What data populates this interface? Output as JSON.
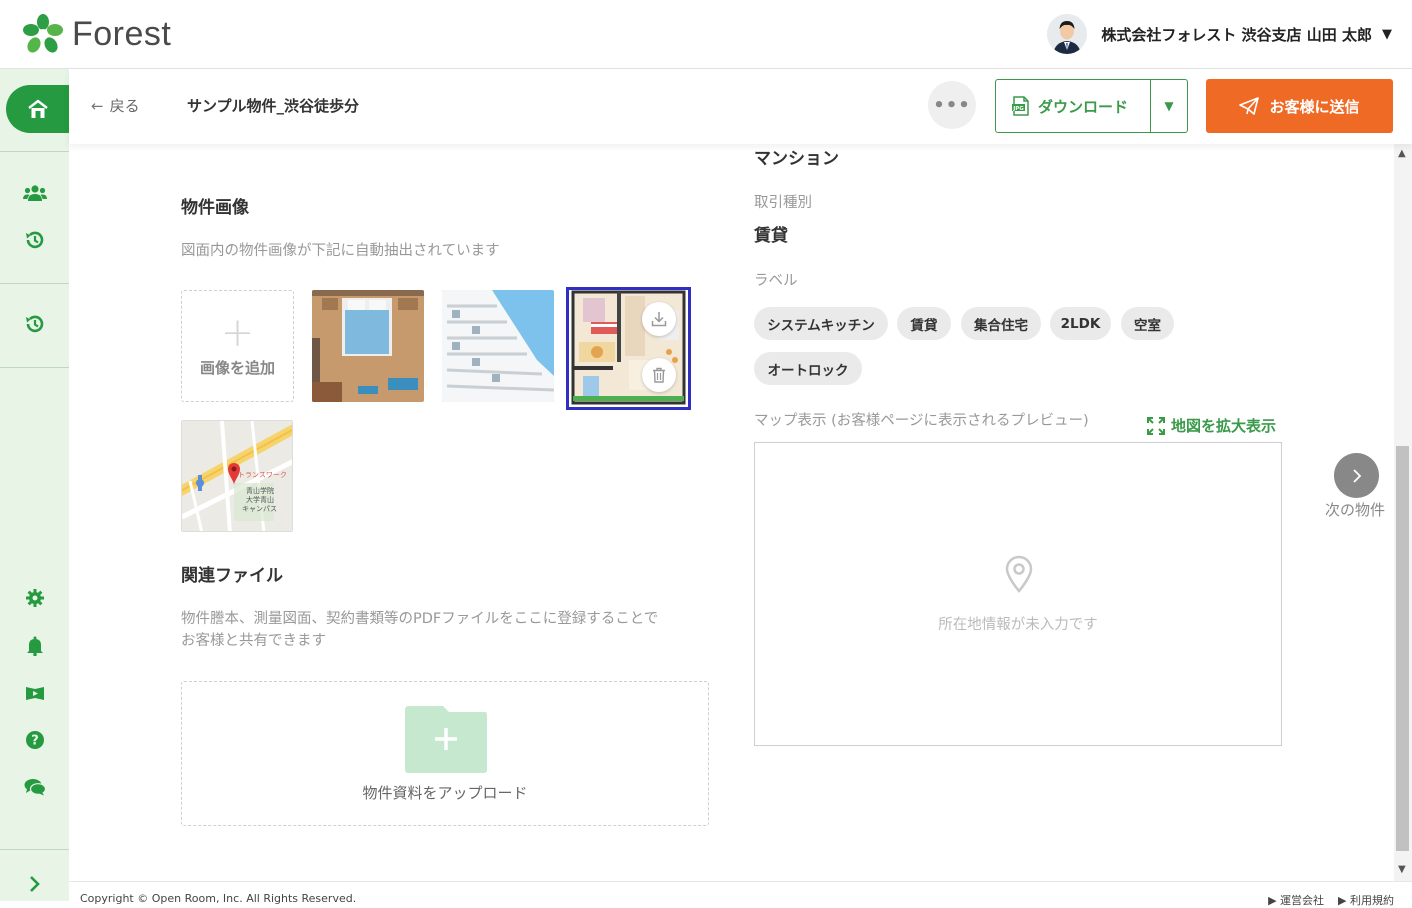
{
  "header": {
    "logo_text": "Forest",
    "user_name": "株式会社フォレスト 渋谷支店 山田 太郎",
    "user_caret": "▼"
  },
  "subbar": {
    "back_label": "戻る",
    "property_title": "サンプル物件_渋谷徒歩分",
    "more_label": "•••",
    "download_label": "ダウンロード",
    "send_label": "お客様に送信"
  },
  "images_section": {
    "title": "物件画像",
    "hint": "図面内の物件画像が下記に自動抽出されています",
    "add_label": "画像を追加",
    "map_thumb_texts": [
      "トランスワーク",
      "青山学院",
      "大学青山",
      "キャンパス"
    ]
  },
  "files_section": {
    "title": "関連ファイル",
    "hint_line1": "物件謄本、測量図面、契約書類等のPDFファイルをここに登録することで",
    "hint_line2": "お客様と共有できます",
    "upload_label": "物件資料をアップロード"
  },
  "details": {
    "building_type": "マンション",
    "transaction_label": "取引種別",
    "transaction_value": "賃貸",
    "label_heading": "ラベル",
    "tags": [
      "システムキッチン",
      "賃貸",
      "集合住宅",
      "2LDK",
      "空室",
      "オートロック"
    ],
    "map_label": "マップ表示 (お客様ページに表示されるプレビュー)",
    "map_expand": "地図を拡大表示",
    "map_empty": "所在地情報が未入力です"
  },
  "nav": {
    "next_label": "次の物件"
  },
  "footer": {
    "copyright": "Copyright © Open Room, Inc. All Rights Reserved.",
    "link1": "運営会社",
    "link2": "利用規約"
  },
  "colors": {
    "brand_green": "#259a40",
    "accent_orange": "#ee6a25",
    "selection_blue": "#2f2fc2"
  }
}
